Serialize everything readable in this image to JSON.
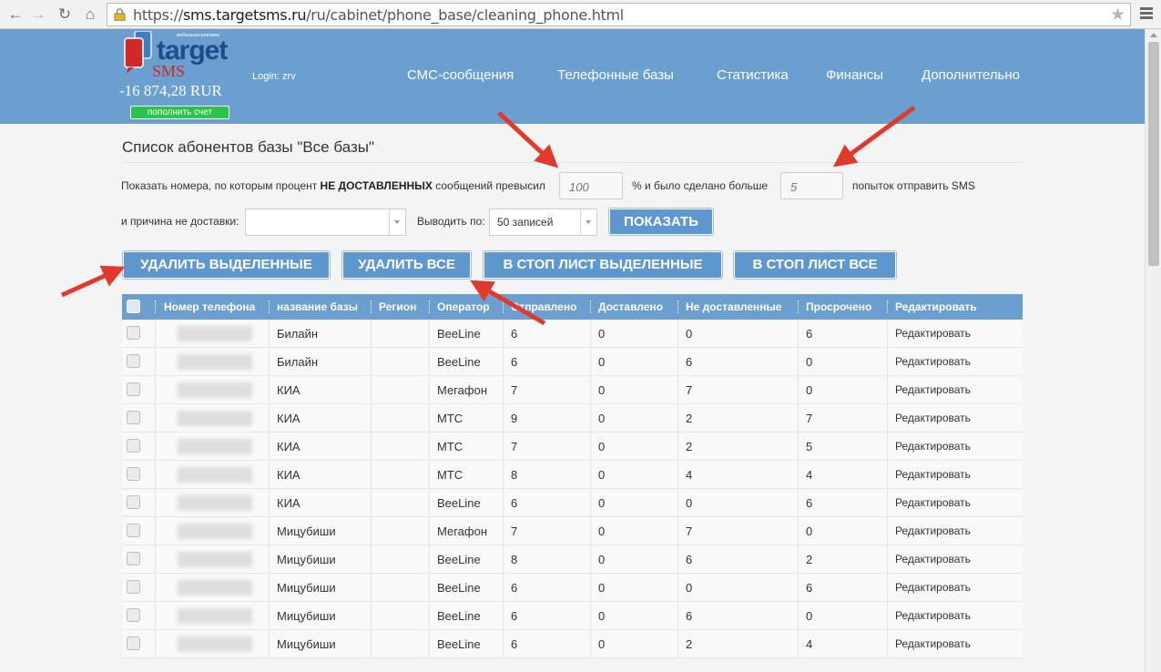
{
  "browser": {
    "url_host": "sms.targetsms.ru",
    "url_path": "/ru/cabinet/phone_base/cleaning_phone.html",
    "url_scheme": "https://"
  },
  "header": {
    "logo_small": "мобильная реклама",
    "logo_target": "target",
    "logo_sms": "SMS",
    "balance": "-16 874,28 RUR",
    "topup_label": "пополнить счет",
    "login": "Login: zrv",
    "nav": [
      "СМС-сообщения",
      "Телефонные базы",
      "Статистика",
      "Финансы",
      "Дополнительно"
    ]
  },
  "page": {
    "title": "Список абонентов базы \"Все базы\"",
    "filter_prefix": "Показать номера, по которым процент ",
    "filter_bold": "НЕ ДОСТАВЛЕННЫХ",
    "filter_suffix": " сообщений превысил",
    "percent_value": "100",
    "label_more": "% и было сделано больше",
    "attempts_value": "5",
    "label_attempts": "попыток отправить SMS",
    "label_reason": "и причина не доставки:",
    "reason_value": "",
    "label_show": "Выводить по:",
    "show_value": "50 записей",
    "show_button": "ПОКАЗАТЬ"
  },
  "actions": {
    "delete_selected": "УДАЛИТЬ ВЫДЕЛЕННЫЕ",
    "delete_all": "УДАЛИТЬ ВСЕ",
    "stoplist_selected": "В СТОП ЛИСТ ВЫДЕЛЕННЫЕ",
    "stoplist_all": "В СТОП ЛИСТ ВСЕ"
  },
  "table": {
    "headers": [
      "Номер телефона",
      "название базы",
      "Регион",
      "Оператор",
      "Отправлено",
      "Доставлено",
      "Не доставленные",
      "Просрочено",
      "Редактировать"
    ],
    "rows": [
      {
        "base": "Билайн",
        "region": "",
        "operator": "BeeLine",
        "sent": "6",
        "delivered": "0",
        "undelivered": "0",
        "expired": "6",
        "edit": "Редактировать"
      },
      {
        "base": "Билайн",
        "region": "",
        "operator": "BeeLine",
        "sent": "6",
        "delivered": "0",
        "undelivered": "6",
        "expired": "0",
        "edit": "Редактировать"
      },
      {
        "base": "КИА",
        "region": "",
        "operator": "Мегафон",
        "sent": "7",
        "delivered": "0",
        "undelivered": "7",
        "expired": "0",
        "edit": "Редактировать"
      },
      {
        "base": "КИА",
        "region": "",
        "operator": "МТС",
        "sent": "9",
        "delivered": "0",
        "undelivered": "2",
        "expired": "7",
        "edit": "Редактировать"
      },
      {
        "base": "КИА",
        "region": "",
        "operator": "МТС",
        "sent": "7",
        "delivered": "0",
        "undelivered": "2",
        "expired": "5",
        "edit": "Редактировать"
      },
      {
        "base": "КИА",
        "region": "",
        "operator": "МТС",
        "sent": "8",
        "delivered": "0",
        "undelivered": "4",
        "expired": "4",
        "edit": "Редактировать"
      },
      {
        "base": "КИА",
        "region": "",
        "operator": "BeeLine",
        "sent": "6",
        "delivered": "0",
        "undelivered": "0",
        "expired": "6",
        "edit": "Редактировать"
      },
      {
        "base": "Мицубиши",
        "region": "",
        "operator": "Мегафон",
        "sent": "7",
        "delivered": "0",
        "undelivered": "7",
        "expired": "0",
        "edit": "Редактировать"
      },
      {
        "base": "Мицубиши",
        "region": "",
        "operator": "BeeLine",
        "sent": "8",
        "delivered": "0",
        "undelivered": "6",
        "expired": "2",
        "edit": "Редактировать"
      },
      {
        "base": "Мицубиши",
        "region": "",
        "operator": "BeeLine",
        "sent": "6",
        "delivered": "0",
        "undelivered": "0",
        "expired": "6",
        "edit": "Редактировать"
      },
      {
        "base": "Мицубиши",
        "region": "",
        "operator": "BeeLine",
        "sent": "6",
        "delivered": "0",
        "undelivered": "6",
        "expired": "0",
        "edit": "Редактировать"
      },
      {
        "base": "Мицубиши",
        "region": "",
        "operator": "BeeLine",
        "sent": "6",
        "delivered": "0",
        "undelivered": "2",
        "expired": "4",
        "edit": "Редактировать"
      }
    ]
  },
  "colors": {
    "header_bg": "#6a9fd0",
    "button_bg": "#5f97cf",
    "arrow": "#e03a2c",
    "topup": "#2bc34a"
  }
}
